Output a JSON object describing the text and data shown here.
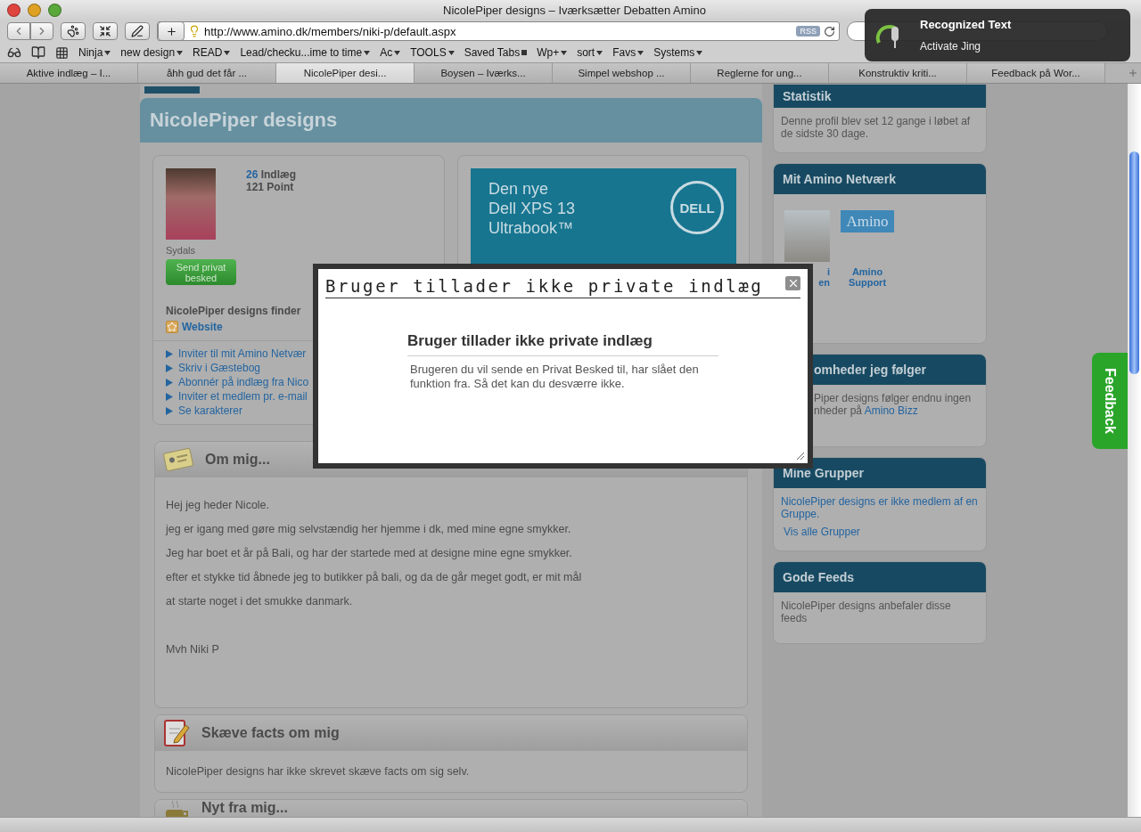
{
  "window": {
    "title": "NicolePiper designs – Iværksætter Debatten Amino"
  },
  "toolbar": {
    "url": "http://www.amino.dk/members/niki-p/default.aspx",
    "rss": "RSS"
  },
  "bookmarks": [
    {
      "label": "Ninja",
      "kind": "menu"
    },
    {
      "label": "new design",
      "kind": "menu"
    },
    {
      "label": "READ",
      "kind": "menu"
    },
    {
      "label": "Lead/checku...ime to time",
      "kind": "menu"
    },
    {
      "label": "Ac",
      "kind": "menu"
    },
    {
      "label": "TOOLS",
      "kind": "menu"
    },
    {
      "label": "Saved Tabs",
      "kind": "tabs"
    },
    {
      "label": "Wp+",
      "kind": "menu"
    },
    {
      "label": "sort",
      "kind": "menu"
    },
    {
      "label": "Favs",
      "kind": "menu"
    },
    {
      "label": "Systems",
      "kind": "menu"
    }
  ],
  "tabs": [
    {
      "label": "Aktive indlæg – I...",
      "selected": false
    },
    {
      "label": "åhh gud det får ...",
      "selected": false
    },
    {
      "label": "NicolePiper desi...",
      "selected": true
    },
    {
      "label": "Boysen – Iværks...",
      "selected": false
    },
    {
      "label": "Simpel webshop ...",
      "selected": false
    },
    {
      "label": "Reglerne for ung...",
      "selected": false
    },
    {
      "label": "Konstruktiv kriti...",
      "selected": false
    },
    {
      "label": "Feedback på Wor...",
      "selected": false
    }
  ],
  "notification": {
    "title": "Recognized Text",
    "action": "Activate Jing"
  },
  "page": {
    "title": "NicolePiper designs",
    "profile": {
      "posts_count": "26",
      "posts_label": "Indlæg",
      "points": "121 Point",
      "location": "Sydals",
      "message_button": "Send privat besked",
      "finder_text": "NicolePiper designs finder",
      "website": "Website",
      "actions": [
        "Inviter til mit Amino Netvær",
        "Skriv i Gæstebog",
        "Abonnér på indlæg fra Nico",
        "Inviter et medlem pr. e-mail",
        "Se karakterer"
      ]
    },
    "ad": {
      "lines": [
        "Den nye",
        "Dell XPS 13",
        "Ultrabook™"
      ],
      "logo": "DELL"
    },
    "sections": [
      {
        "kind": "about",
        "title": "Om mig...",
        "paragraphs": [
          {
            "kind": "line",
            "text": "Hej jeg heder Nicole."
          },
          {
            "kind": "line",
            "text": "jeg er igang med gøre mig selvstændig her hjemme i dk, med mine egne smykker."
          },
          {
            "kind": "line",
            "text": "Jeg har boet et år på Bali, og har der startede med at designe mine egne smykker."
          },
          {
            "kind": "line",
            "text": "efter et stykke tid åbnede jeg to butikker på bali, og da de går meget godt, er mit mål"
          },
          {
            "kind": "line",
            "text": "at starte noget i det smukke danmark."
          },
          {
            "kind": "signature",
            "text": "Mvh Niki P"
          }
        ]
      },
      {
        "kind": "facts",
        "title": "Skæve facts om mig",
        "paragraphs": [
          {
            "kind": "line",
            "text": "NicolePiper designs har ikke skrevet skæve facts om sig selv."
          }
        ]
      },
      {
        "kind": "news",
        "title": "Nyt fra mig..."
      }
    ]
  },
  "sidebar": [
    {
      "title": "Statistik",
      "body": [
        {
          "kind": "paragraph",
          "parts": [
            {
              "text": "Denne profil blev set 12 gange i løbet af de sidste 30 dage.",
              "link": false
            }
          ]
        }
      ]
    },
    {
      "title": "Mit Amino Netværk",
      "body": [
        {
          "kind": "members",
          "members": [
            {
              "kind": "photo",
              "name": [
                "i",
                "en"
              ]
            },
            {
              "kind": "logo",
              "logo": "Amino",
              "name": [
                "Amino",
                "Support"
              ]
            }
          ]
        }
      ]
    },
    {
      "title": "omheder jeg følger",
      "body": [
        {
          "kind": "paragraph",
          "parts": [
            {
              "text": "Piper designs følger endnu ingen",
              "link": false
            }
          ]
        },
        {
          "kind": "paragraph",
          "parts": [
            {
              "text": "nheder på",
              "link": false
            },
            {
              "text": "Amino Bizz",
              "link": true
            }
          ]
        }
      ]
    },
    {
      "title": "Mine Grupper",
      "body": [
        {
          "kind": "paragraph",
          "parts": [
            {
              "text": "NicolePiper designs er ikke medlem af en Gruppe.",
              "link": true
            }
          ]
        },
        {
          "kind": "more",
          "parts": [
            {
              "text": "Vis alle Grupper",
              "link": true
            }
          ]
        }
      ]
    },
    {
      "title": "Gode Feeds",
      "body": [
        {
          "kind": "paragraph",
          "parts": [
            {
              "text": "NicolePiper designs anbefaler disse feeds",
              "link": false
            }
          ]
        }
      ]
    }
  ],
  "feedback": "Feedback",
  "modal": {
    "title": "Bruger tillader ikke private indlæg",
    "heading": "Bruger tillader ikke private indlæg",
    "message": "Brugeren du vil sende en Privat Besked til, har slået den funktion fra. Så det kan du desværre ikke."
  }
}
